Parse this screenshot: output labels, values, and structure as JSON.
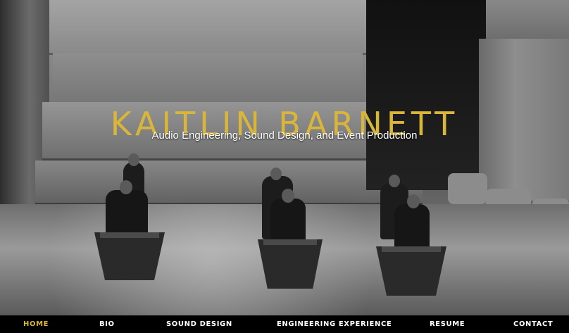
{
  "hero": {
    "title": "KAITLIN BARNETT",
    "subtitle": "Audio Engineering, Sound Design, and Event Production"
  },
  "nav": {
    "items": [
      {
        "label": "HOME",
        "active": true
      },
      {
        "label": "BIO",
        "active": false
      },
      {
        "label": "SOUND DESIGN",
        "active": false
      },
      {
        "label": "ENGINEERING EXPERIENCE",
        "active": false
      },
      {
        "label": "RESUME",
        "active": false
      },
      {
        "label": "CONTACT",
        "active": false
      }
    ]
  },
  "colors": {
    "accent": "#d9b63a",
    "nav_background": "#000000",
    "nav_text": "#ffffff"
  }
}
